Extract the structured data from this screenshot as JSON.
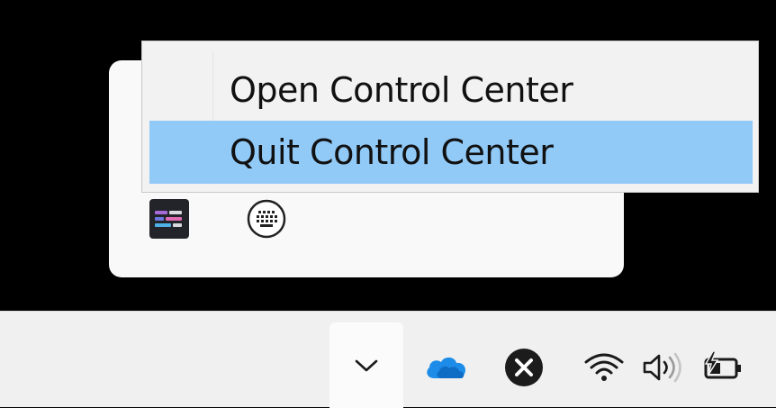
{
  "context_menu": {
    "items": [
      {
        "label": "Open Control Center",
        "highlighted": false
      },
      {
        "label": "Quit Control Center",
        "highlighted": true
      }
    ],
    "highlight_color": "#91c9f7"
  },
  "tray_flyout": {
    "icons": [
      "control-center-icon",
      "keyboard-icon"
    ]
  },
  "taskbar": {
    "tray_icons": [
      "chevron-up-icon",
      "onedrive-icon",
      "close-circle-icon",
      "wifi-icon",
      "volume-icon",
      "battery-charging-icon"
    ],
    "onedrive_color": "#1d8ce8"
  }
}
